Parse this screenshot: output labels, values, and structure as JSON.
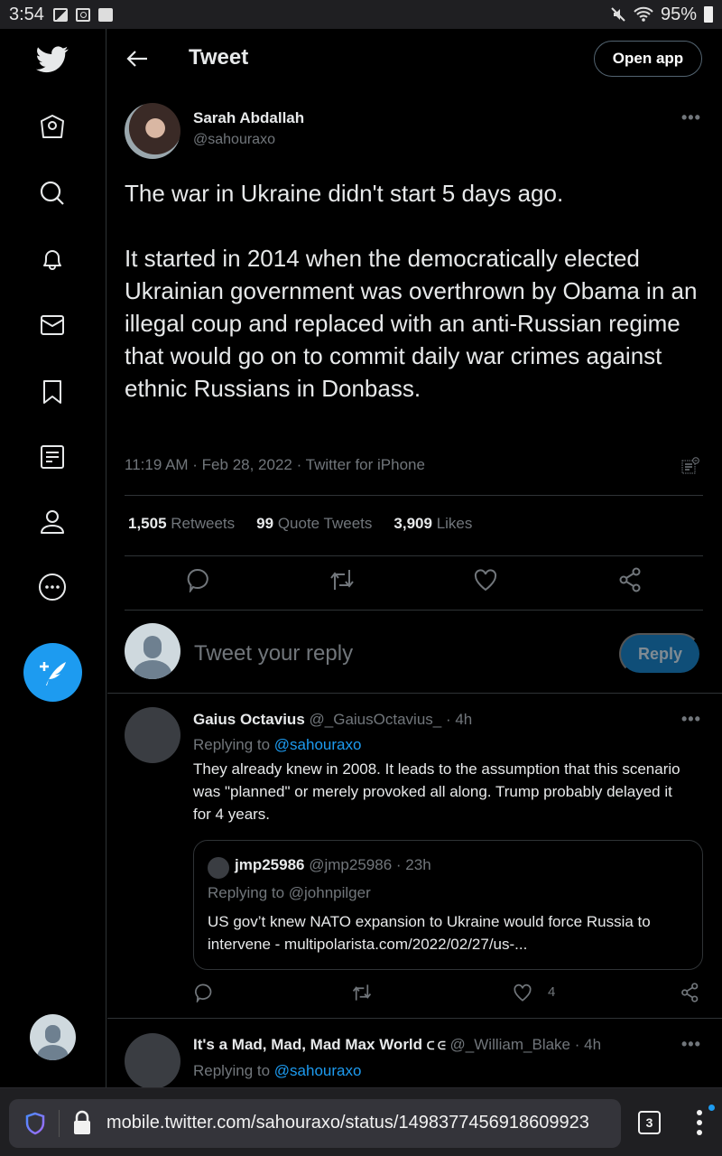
{
  "status_bar": {
    "time": "3:54",
    "battery": "95%",
    "left_icons": [
      "image-icon",
      "screen-record-icon",
      "checkbox-icon"
    ],
    "right_icons": [
      "mute-icon",
      "wifi-icon",
      "battery-icon"
    ]
  },
  "sidebar": {
    "logo": "twitter-bird-icon",
    "items": [
      {
        "name": "home",
        "icon": "home-icon"
      },
      {
        "name": "explore",
        "icon": "search-icon"
      },
      {
        "name": "notifications",
        "icon": "bell-icon"
      },
      {
        "name": "messages",
        "icon": "mail-icon"
      },
      {
        "name": "bookmarks",
        "icon": "bookmark-icon"
      },
      {
        "name": "lists",
        "icon": "list-icon"
      },
      {
        "name": "profile",
        "icon": "person-icon"
      },
      {
        "name": "more",
        "icon": "more-circle-icon"
      }
    ],
    "compose_icon": "compose-tweet-icon"
  },
  "header": {
    "title": "Tweet",
    "open_app_label": "Open app"
  },
  "tweet": {
    "author_name": "Sarah Abdallah",
    "author_handle": "@sahouraxo",
    "more": "•••",
    "text": "The war in Ukraine didn't start 5 days ago.\n\nIt started in 2014 when the democratically elected Ukrainian government was overthrown by Obama in an illegal coup and replaced with an anti-Russian regime that would go on to commit daily war crimes against ethnic Russians in Donbass.",
    "meta": "11:19 AM · Feb 28, 2022 · Twitter for iPhone",
    "stats": {
      "retweets_count": "1,505",
      "retweets_label": "Retweets",
      "quotes_count": "99",
      "quotes_label": "Quote Tweets",
      "likes_count": "3,909",
      "likes_label": "Likes"
    }
  },
  "reply_box": {
    "placeholder": "Tweet your reply",
    "button_label": "Reply"
  },
  "replies": [
    {
      "name": "Gaius Octavius",
      "handle": "@_GaiusOctavius_",
      "time": "· 4h",
      "replying_prefix": "Replying to ",
      "replying_to": "@sahouraxo",
      "text": "They already knew in 2008. It leads to the assumption that this scenario was \"planned\" or merely provoked all along. Trump probably delayed it for 4 years.",
      "more": "•••",
      "like_count": "4",
      "quote": {
        "name": "jmp25986",
        "handle": "@jmp25986",
        "time": "· 23h",
        "replying": "Replying to @johnpilger",
        "text": "US gov’t knew NATO expansion to Ukraine would force Russia to intervene - multipolarista.com/2022/02/27/us-..."
      }
    },
    {
      "name": "It's a Mad, Mad, Mad Max World",
      "name_suffix": "ᑕ ᕮ",
      "handle": "@_William_Blake",
      "time": "· 4h",
      "replying_prefix": "Replying to ",
      "replying_to": "@sahouraxo",
      "more": "•••"
    }
  ],
  "browser": {
    "url": "mobile.twitter.com/sahouraxo/status/1498377456918609923",
    "tab_count": "3"
  },
  "colors": {
    "accent": "#1d9bf0",
    "reply_button_bg": "#0f4e78",
    "muted_text": "#71767b",
    "divider": "#2f3336"
  }
}
